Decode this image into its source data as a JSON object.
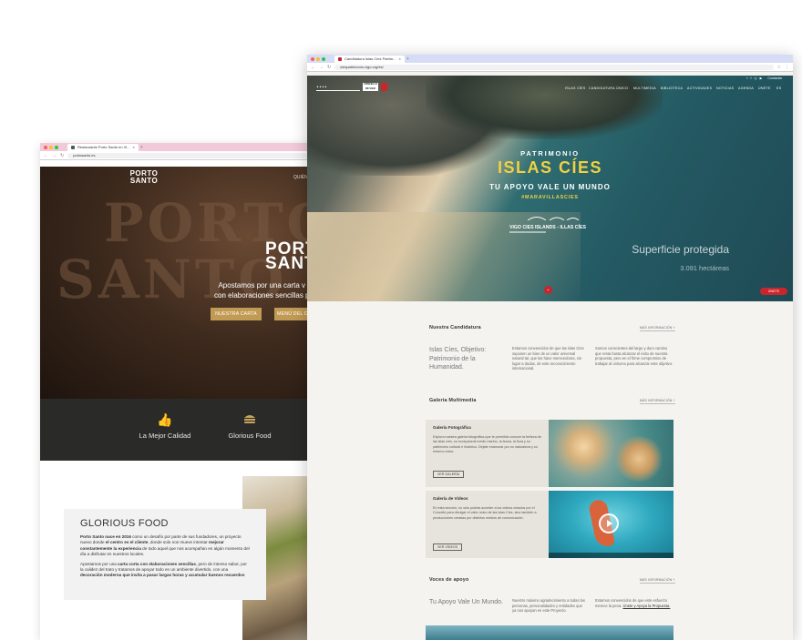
{
  "back_window": {
    "tab_title": "Restaurante Porto Santo en Vi...",
    "url": "portosanto.es",
    "logo": "PORTO SANTO",
    "nav_fragment": "QUIÉN",
    "hero_heading_1": "PORTO",
    "hero_heading_2": "SANTO",
    "hero_text_1": "Apostamos por una carta v",
    "hero_text_2": "con elaboraciones sencillas p",
    "btn_menu": "NUESTRA CARTA",
    "btn_menu2": "MENÚ DEL D",
    "features": [
      {
        "label": "La Mejor Calidad",
        "icon": "thumbs-up-icon"
      },
      {
        "label": "Glorious Food",
        "icon": "burger-icon"
      }
    ],
    "card_title": "GLORIOUS FOOD",
    "card_p1_a": "Porto Santo nace en 2016",
    "card_p1_b": " como un desafío por parte de sus fundadores, un proyecto nuevo donde ",
    "card_p1_c": "el centro es el cliente",
    "card_p1_d": ", donde solo nos mueve intentar ",
    "card_p1_e": "mejorar constantemente la experiencia",
    "card_p1_f": " de todo aquel que nos acompañan en algún momento del día a disfrutar en nuestros locales.",
    "card_p2_a": "Apostamos por una ",
    "card_p2_b": "carta corta con elaboraciones sencillas",
    "card_p2_c": ", pero de intenso sabor, por la calidez del trato y tratamos de apoyar todo en un ambiente divertido, con una ",
    "card_p2_d": "decoración moderna que invita a pasar largas horas y acumular buenos recuerdos",
    "accent": "#c19a53"
  },
  "front_window": {
    "tab_title": "Candidatura Islas Cíes Patrim...",
    "url": "ciespatrimonio.vigo.org/es/",
    "nav": [
      "ISLAS CÍES",
      "CANDIDATURA ÚNICO",
      "MULTIMEDIA",
      "BIBLIOTECA",
      "ACTIVIDADES",
      "NOTICIAS",
      "AGENDA",
      "ÚNETE",
      "ES"
    ],
    "contact": "Contactar",
    "hero_patrimonio": "PATRIMONIO",
    "hero_islas": "ISLAS CÍES",
    "hero_apoyo": "TU APOYO VALE UN MUNDO",
    "hero_hashtag": "#MARAVILLASCIES",
    "hero_vigo": "VIGO",
    "hero_cies_islands": "CIES ISLANDS - ILLAS CÍES",
    "superficie_title": "Superficie protegida",
    "superficie_value": "3.091 hectáreas",
    "unete_btn": "ÚNETE",
    "candidatura_title": "Nuestra Candidatura",
    "more_info": "MÁS INFORMACIÓN +",
    "objective": "Islas Cíes, Objetivo: Patrimonio de la Humanidad.",
    "col1": "Estamos convencidos de que las islas Cíes suponen un bien de un valor universal natural tal, que las hace merecedoras, sin lugar a dudas, de este reconocimiento internacional.",
    "col2": "Somos conscientes del largo y duro camino que resta hasta alcanzar el éxito de nuestra propuesta, pero en el firme compromiso de trabajar al unísono para alcanzar este objetivo.",
    "galeria_title": "Galeria Multimedia",
    "foto_title": "Galería Fotográfica",
    "foto_text": "Explora nuestra galería fotográfica que te permitirá conocer la belleza de las islas cíes, su excepcional medio marino, la fauna, la flora y su patrimonio cultural e histórico. Déjate enamorar por su naturaleza y su entorno único.",
    "foto_btn": "VER GALERÍA",
    "video_title": "Galería de Vídeos",
    "video_text": "En esta sección, no sólo podrás acceder a los vídeos creados por el Concello para divulgar el valor único de las Islas Cíes, sino también a producciones creadas por distintos medios de comunicación.",
    "video_btn": "VER VÍDEOS",
    "voces_title": "Voces de apoyo",
    "voces_slogan": "Tu Apoyo Vale Un Mundo.",
    "voces_col1": "Nuestro máximo agradecimiento a todas las personas, personalidades y entidades que ya nos apoyan en este Proyecto.",
    "voces_col2_a": "Estamos convencidos de que este esfuerzo merece la pena. ",
    "voces_col2_b": "Únete y Apoya la Propuesta.",
    "accent_red": "#c8252d",
    "accent_yellow": "#f2d140"
  }
}
